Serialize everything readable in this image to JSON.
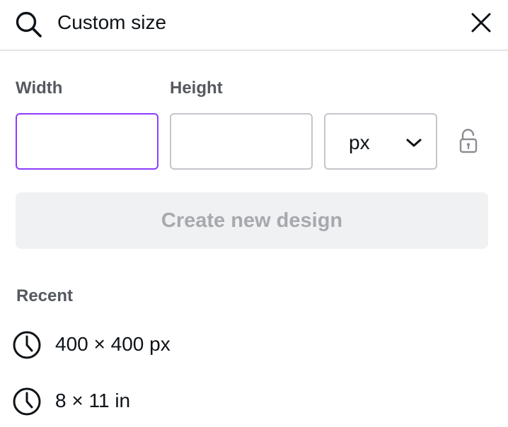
{
  "search": {
    "query": "Custom size",
    "icon": "search-icon",
    "close_icon": "close-icon"
  },
  "size_form": {
    "width_label": "Width",
    "height_label": "Height",
    "width_value": "",
    "height_value": "",
    "unit": "px",
    "unit_icon": "chevron-down-icon",
    "lock_icon": "unlocked-padlock-icon",
    "width_field_focused": true
  },
  "create_button": {
    "label": "Create new design",
    "enabled": false
  },
  "recent": {
    "heading": "Recent",
    "items": [
      {
        "label": "400 × 400 px",
        "icon": "clock-icon"
      },
      {
        "label": "8 × 11 in",
        "icon": "clock-icon"
      }
    ]
  },
  "colors": {
    "text": "#0e1318",
    "label": "#55595f",
    "focus_border": "#8b3dff",
    "field_border": "#c3c6cb",
    "disabled_button_bg": "#f0f1f3",
    "disabled_button_text": "#a6a9ae",
    "divider": "#e4e6ea"
  }
}
